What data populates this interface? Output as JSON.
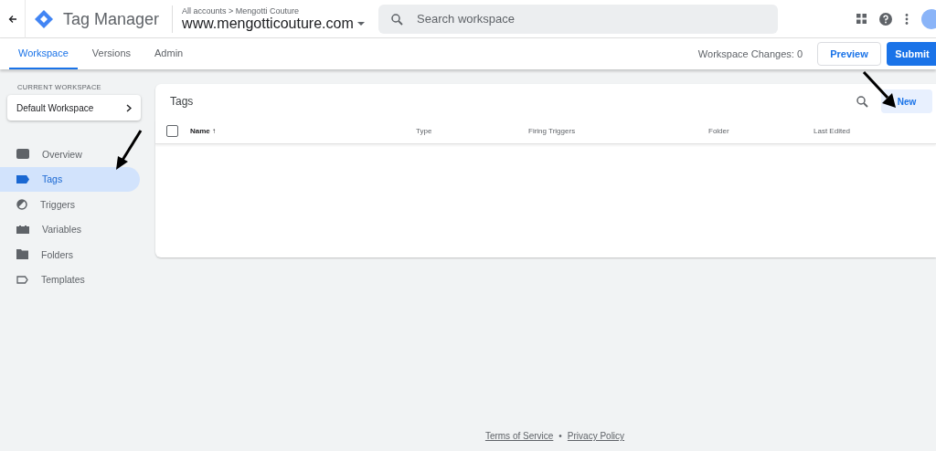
{
  "header": {
    "product": "Tag Manager",
    "breadcrumb": "All accounts > Mengotti Couture",
    "container": "www.mengotticouture.com",
    "search": {
      "placeholder": "Search workspace"
    }
  },
  "tabs": [
    {
      "label": "Workspace",
      "selected": true
    },
    {
      "label": "Versions",
      "selected": false
    },
    {
      "label": "Admin",
      "selected": false
    }
  ],
  "workspace_changes": "Workspace Changes: 0",
  "buttons": {
    "preview": "Preview",
    "submit": "Submit"
  },
  "sidebar": {
    "section_label": "CURRENT WORKSPACE",
    "workspace": "Default Workspace",
    "items": [
      {
        "label": "Overview",
        "kind": "overview",
        "selected": false
      },
      {
        "label": "Tags",
        "kind": "tags",
        "selected": true
      },
      {
        "label": "Triggers",
        "kind": "triggers",
        "selected": false
      },
      {
        "label": "Variables",
        "kind": "variables",
        "selected": false
      },
      {
        "label": "Folders",
        "kind": "folders",
        "selected": false
      },
      {
        "label": "Templates",
        "kind": "templates",
        "selected": false
      }
    ]
  },
  "tags_card": {
    "title": "Tags",
    "new_button": "New",
    "checked": false,
    "columns": [
      "Name ↑",
      "Type",
      "Firing Triggers",
      "Folder",
      "Last Edited"
    ]
  },
  "footer": {
    "links": [
      "Terms of Service",
      "Privacy Policy"
    ],
    "separator": "•"
  }
}
